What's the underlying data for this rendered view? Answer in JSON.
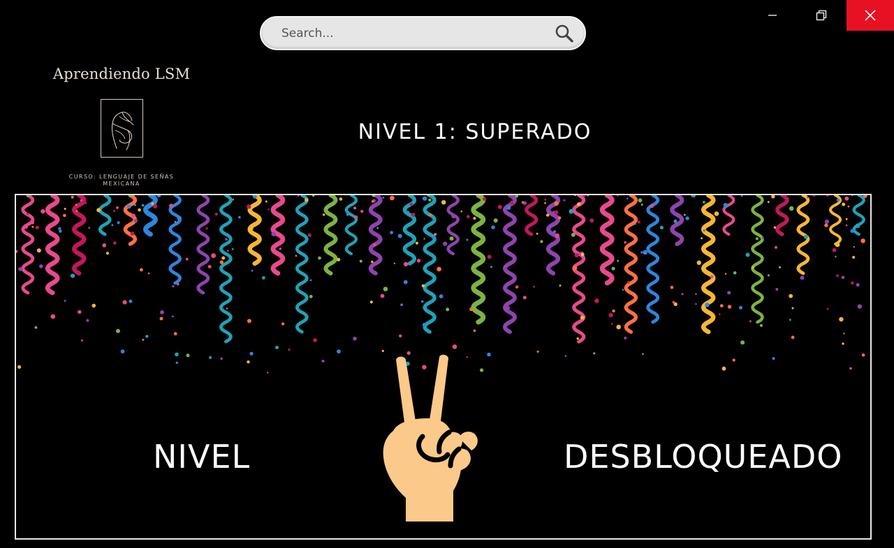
{
  "search": {
    "placeholder": "Search..."
  },
  "logo": {
    "title": "Aprendiendo LSM",
    "subtitle_line1": "CURSO: LENGUAJE DE SEÑAS",
    "subtitle_line2": "MEXICANA"
  },
  "level_title": "NIVEL 1: SUPERADO",
  "banner": {
    "left_word": "NIVEL",
    "right_word": "DESBLOQUEADO"
  },
  "icons": {
    "minimize": "minimize-icon",
    "maximize": "restore-icon",
    "close": "close-icon",
    "search": "search-icon",
    "hand": "peace-hand-icon",
    "logo_hand": "sign-hand-icon"
  },
  "colors": {
    "close_bg": "#e81123",
    "hand": "#fbc98a",
    "confetti": [
      "#e84a8c",
      "#f7b733",
      "#c2185b",
      "#1fa2b8",
      "#ff7043",
      "#8e44ad",
      "#7cb342",
      "#2e86de"
    ]
  }
}
